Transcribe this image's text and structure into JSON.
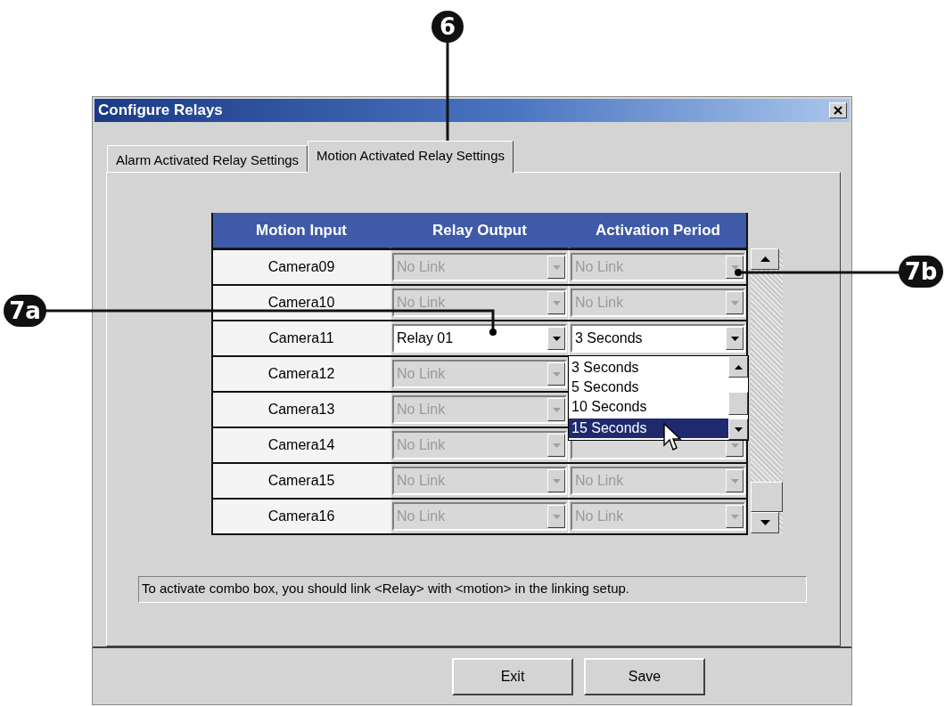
{
  "callouts": [
    {
      "label": "6",
      "kind": "top"
    },
    {
      "label": "7a",
      "kind": "left"
    },
    {
      "label": "7b",
      "kind": "right"
    }
  ],
  "window": {
    "title": "Configure Relays"
  },
  "tabs": [
    {
      "label": "Alarm Activated Relay Settings",
      "selected": false
    },
    {
      "label": "Motion Activated Relay Settings",
      "selected": true
    }
  ],
  "table": {
    "columns": [
      "Motion Input",
      "Relay Output",
      "Activation Period"
    ],
    "rows": [
      {
        "input": "Camera09",
        "relay_output": {
          "value": "No Link",
          "disabled": true
        },
        "activation_period": {
          "value": "No Link",
          "disabled": true
        }
      },
      {
        "input": "Camera10",
        "relay_output": {
          "value": "No Link",
          "disabled": true
        },
        "activation_period": {
          "value": "No Link",
          "disabled": true
        }
      },
      {
        "input": "Camera11",
        "relay_output": {
          "value": "Relay 01",
          "disabled": false
        },
        "activation_period": {
          "value": "3 Seconds",
          "disabled": false
        }
      },
      {
        "input": "Camera12",
        "relay_output": {
          "value": "No Link",
          "disabled": true
        }
      },
      {
        "input": "Camera13",
        "relay_output": {
          "value": "No Link",
          "disabled": true
        }
      },
      {
        "input": "Camera14",
        "relay_output": {
          "value": "No Link",
          "disabled": true
        },
        "activation_period": {
          "disabled": true
        }
      },
      {
        "input": "Camera15",
        "relay_output": {
          "value": "No Link",
          "disabled": true
        },
        "activation_period": {
          "value": "No Link",
          "disabled": true
        }
      },
      {
        "input": "Camera16",
        "relay_output": {
          "value": "No Link",
          "disabled": true
        },
        "activation_period": {
          "value": "No Link",
          "disabled": true
        }
      }
    ]
  },
  "dropdown": {
    "options": [
      {
        "label": "3 Seconds",
        "selected": false
      },
      {
        "label": "5 Seconds",
        "selected": false
      },
      {
        "label": "10 Seconds",
        "selected": false
      },
      {
        "label": "15 Seconds",
        "selected": true
      }
    ]
  },
  "hint": "To activate combo box, you should link <Relay> with <motion> in the linking setup.",
  "buttons": [
    "Exit",
    "Save"
  ]
}
